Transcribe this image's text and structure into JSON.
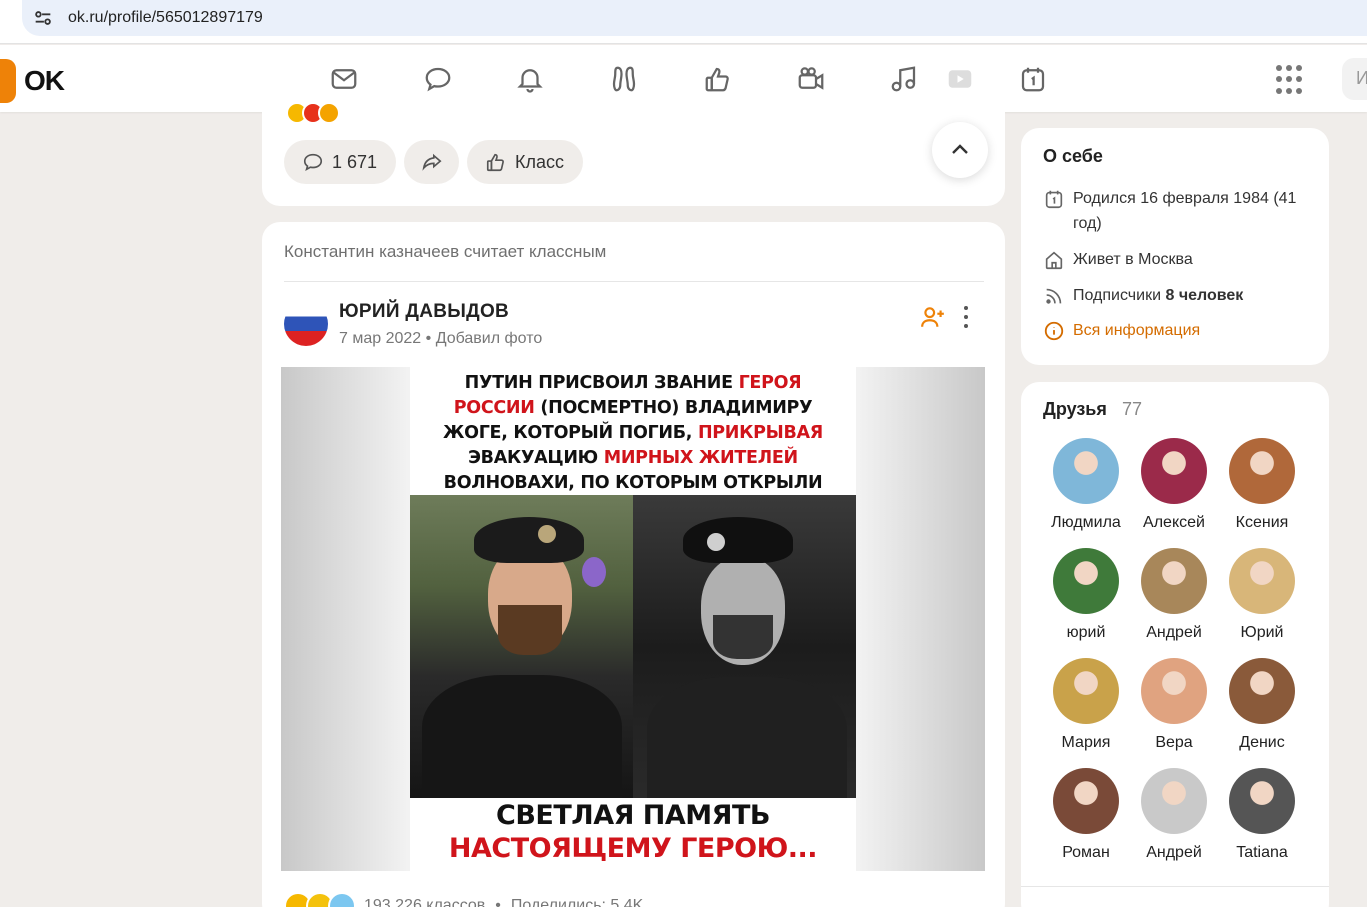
{
  "browser": {
    "url": "ok.ru/profile/565012897179"
  },
  "header": {
    "logo_text": "OK",
    "nav_icons": [
      "messages-icon",
      "discussions-icon",
      "notifications-icon",
      "guests-icon",
      "events-icon",
      "video-icon",
      "music-icon",
      "play-icon",
      "calendar-icon"
    ],
    "search_stub": "И",
    "accent": "#ee8208"
  },
  "post_prev": {
    "comments_count": "1 671",
    "class_label": "Класс"
  },
  "post": {
    "liked_by": "Константин казначеев считает классным",
    "author": "ЮРИЙ ДАВЫДОВ",
    "date": "7 мар 2022",
    "action": "Добавил фото",
    "photo": {
      "headline_parts": [
        {
          "t": "ПУТИН ПРИСВОИЛ ЗВАНИЕ ",
          "red": false
        },
        {
          "t": "ГЕРОЯ РОССИИ",
          "red": true
        },
        {
          "t": " (ПОСМЕРТНО) ВЛАДИМИРУ ЖОГЕ, КОТОРЫЙ ПОГИБ, ",
          "red": false
        },
        {
          "t": "ПРИКРЫВАЯ",
          "red": true
        },
        {
          "t": " ЭВАКУАЦИЮ ",
          "red": false
        },
        {
          "t": "МИРНЫХ ЖИТЕЛЕЙ",
          "red": true
        },
        {
          "t": " ВОЛНОВАХИ, ПО КОТОРЫМ ОТКРЫЛИ ОГОНЬ НАЦИОНАЛИСТЫ...",
          "red": false
        }
      ],
      "footer_line1": "СВЕТЛАЯ ПАМЯТЬ",
      "footer_line2": "НАСТОЯЩЕМУ ГЕРОЮ..."
    },
    "classes_count": "193 226 классов",
    "shares": "Поделились: 5,4K"
  },
  "about": {
    "title": "О себе",
    "born": "Родился 16 февраля 1984 (41 год)",
    "lives_prefix": "Живет в ",
    "lives_city": "Москва",
    "subscribers_label": "Подписчики ",
    "subscribers_value": "8 человек",
    "all_info": "Вся информация"
  },
  "friends": {
    "title": "Друзья",
    "count": "77",
    "list": [
      {
        "name": "Людмила",
        "color": "#7fb7d9"
      },
      {
        "name": "Алексей",
        "color": "#9b2a4a"
      },
      {
        "name": "Ксения",
        "color": "#b0683a"
      },
      {
        "name": "юрий",
        "color": "#3f7a3a"
      },
      {
        "name": "Андрей",
        "color": "#a8875a"
      },
      {
        "name": "Юрий",
        "color": "#d8b679"
      },
      {
        "name": "Мария",
        "color": "#c9a24a"
      },
      {
        "name": "Вера",
        "color": "#e0a380"
      },
      {
        "name": "Денис",
        "color": "#8a5a3a"
      },
      {
        "name": "Роман",
        "color": "#7a4a38"
      },
      {
        "name": "Андрей",
        "color": "#c9c9c9"
      },
      {
        "name": "Tatiana",
        "color": "#555555"
      }
    ]
  }
}
